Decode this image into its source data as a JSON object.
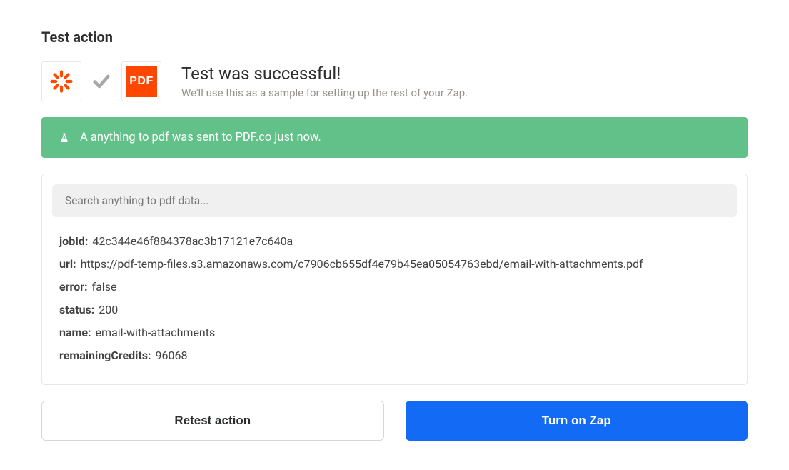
{
  "section_title": "Test action",
  "icons": {
    "zapier_name": "zapier-icon",
    "check_name": "checkmark-icon",
    "pdf_label": "PDF",
    "flask_name": "flask-icon"
  },
  "colors": {
    "banner_bg": "#62c188",
    "primary_btn": "#136bf5",
    "pdf_orange": "#ff4600",
    "zapier_orange": "#ff4a00"
  },
  "result": {
    "title": "Test was successful!",
    "subtitle": "We'll use this as a sample for setting up the rest of your Zap."
  },
  "banner": {
    "text": "A anything to pdf was sent to PDF.co just now."
  },
  "search": {
    "placeholder": "Search anything to pdf data..."
  },
  "data_rows": {
    "jobId": {
      "label": "jobId:",
      "value": "42c344e46f884378ac3b17121e7c640a"
    },
    "url": {
      "label": "url:",
      "value": "https://pdf-temp-files.s3.amazonaws.com/c7906cb655df4e79b45ea05054763ebd/email-with-attachments.pdf"
    },
    "error": {
      "label": "error:",
      "value": "false"
    },
    "status": {
      "label": "status:",
      "value": "200"
    },
    "name": {
      "label": "name:",
      "value": "email-with-attachments"
    },
    "remainingCredits": {
      "label": "remainingCredits:",
      "value": "96068"
    }
  },
  "buttons": {
    "retest": "Retest action",
    "turn_on": "Turn on Zap"
  }
}
